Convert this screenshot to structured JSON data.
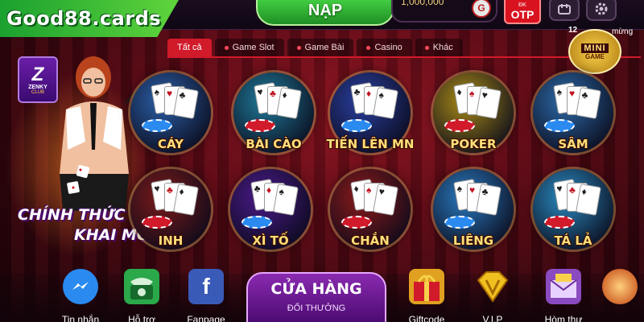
{
  "brand": {
    "name": "Good88.cards"
  },
  "header": {
    "deposit_label": "NẠP",
    "balance": "1,000,000",
    "coin_symbol": "G",
    "otp_sub": "ĐK",
    "otp_label": "OTP"
  },
  "tabs": [
    {
      "label": "Tất cả",
      "active": true
    },
    {
      "label": "Game Slot",
      "active": false
    },
    {
      "label": "Game Bài",
      "active": false
    },
    {
      "label": "Casino",
      "active": false
    },
    {
      "label": "Khác",
      "active": false
    }
  ],
  "promo": {
    "club_letter": "Z",
    "club_name": "ZENKY",
    "club_sub": "CLUB",
    "line1": "CHÍNH THỨC",
    "line2": "KHAI MỞ"
  },
  "mini_game": {
    "badge": "12",
    "note": "mừng",
    "title": "MINI",
    "subtitle": "GAME"
  },
  "games": [
    {
      "label": "CÁY",
      "color": "#2b5fa8"
    },
    {
      "label": "BÀI CÀO",
      "color": "#1f7a9a"
    },
    {
      "label": "TIẾN LÊN MN",
      "color": "#2a3fa0"
    },
    {
      "label": "POKER",
      "color": "#a88a18"
    },
    {
      "label": "SÂM",
      "color": "#2c6aa8"
    },
    {
      "label": "INH",
      "color": "#7a1a1a"
    },
    {
      "label": "XÌ TỐ",
      "color": "#4a1a8a"
    },
    {
      "label": "CHẮN",
      "color": "#8a1a1a"
    },
    {
      "label": "LIÊNG",
      "color": "#2a7ac0"
    },
    {
      "label": "TÁ LẢ",
      "color": "#2a8ac0"
    }
  ],
  "bottom_menu": {
    "items": [
      {
        "label": "Tin nhắn",
        "icon": "messenger-icon",
        "color": "#2a8af0"
      },
      {
        "label": "Hỗ trợ",
        "icon": "phone-icon",
        "color": "#2aa84a"
      },
      {
        "label": "Fanpage",
        "icon": "facebook-icon",
        "color": "#3a5ab8"
      },
      {
        "label": "Giftcode",
        "icon": "gift-icon",
        "color": "#e0a020"
      },
      {
        "label": "V.I.P",
        "icon": "vip-diamond-icon",
        "color": "#f0c020"
      },
      {
        "label": "Hòm thư",
        "icon": "mailbox-icon",
        "color": "#8a4ac0"
      }
    ],
    "shop_title": "CỬA HÀNG",
    "shop_subtitle": "ĐỔI THƯỞNG"
  }
}
